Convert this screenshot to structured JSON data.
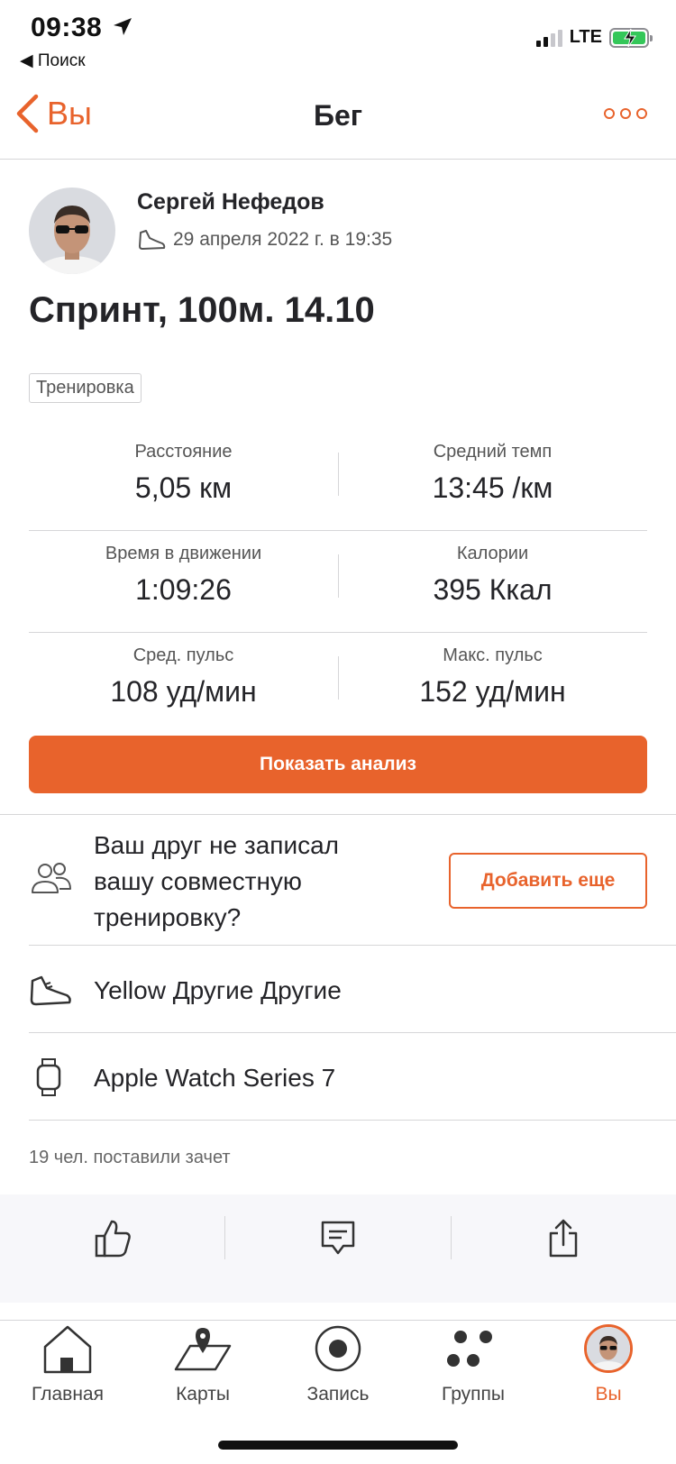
{
  "status_bar": {
    "time": "09:38",
    "back_app": "◀ Поиск",
    "network": "LTE"
  },
  "nav": {
    "back_label": "Вы",
    "title": "Бег"
  },
  "activity": {
    "athlete_name": "Сергей Нефедов",
    "date": "29 апреля 2022 г. в 19:35",
    "title": "Спринт, 100м. 14.10",
    "tag": "Тренировка"
  },
  "stats": [
    [
      {
        "label": "Расстояние",
        "value": "5,05 км"
      },
      {
        "label": "Средний темп",
        "value": "13:45 /км"
      }
    ],
    [
      {
        "label": "Время в движении",
        "value": "1:09:26"
      },
      {
        "label": "Калории",
        "value": "395 Ккал"
      }
    ],
    [
      {
        "label": "Сред. пульс",
        "value": "108 уд/мин"
      },
      {
        "label": "Макс. пульс",
        "value": "152 уд/мин"
      }
    ]
  ],
  "analysis_button": "Показать анализ",
  "friend_prompt": {
    "text": "Ваш друг не записал вашу совместную тренировку?",
    "button": "Добавить еще"
  },
  "gear": {
    "shoes": "Yellow Другие Другие",
    "device": "Apple Watch Series 7"
  },
  "kudos_text": "19 чел. поставили зачет",
  "tab_bar": [
    {
      "label": "Главная",
      "icon": "home-icon"
    },
    {
      "label": "Карты",
      "icon": "map-icon"
    },
    {
      "label": "Запись",
      "icon": "record-icon"
    },
    {
      "label": "Группы",
      "icon": "groups-icon"
    },
    {
      "label": "Вы",
      "icon": "profile-avatar"
    }
  ],
  "colors": {
    "accent": "#e8632c",
    "text": "#242428",
    "muted": "#555555",
    "divider": "#d6d6d8"
  }
}
